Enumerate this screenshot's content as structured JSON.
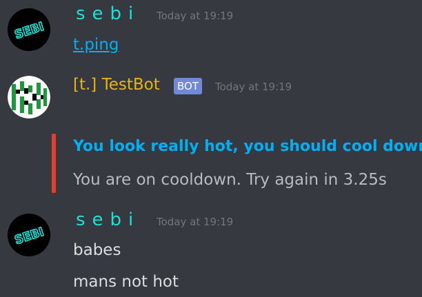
{
  "messages": [
    {
      "author": "sebi",
      "avatar_text": "SEBI",
      "timestamp": "Today at 19:19",
      "lines": [
        "t.ping"
      ]
    },
    {
      "author": "[t.] TestBot",
      "badge": "BOT",
      "timestamp": "Today at 19:19",
      "embed": {
        "title": "You look really hot, you should cool down",
        "description": "You are on cooldown. Try again in 3.25s",
        "color": "#e63d2f"
      }
    },
    {
      "author": "sebi",
      "avatar_text": "SEBI",
      "timestamp": "Today at 19:19",
      "lines": [
        "babes",
        "mans not hot"
      ]
    }
  ],
  "colors": {
    "background": "#36393f",
    "sebi_name": "#1fe0d6",
    "bot_name": "#e5b611",
    "link": "#00b0f4",
    "badge": "#7289da"
  }
}
